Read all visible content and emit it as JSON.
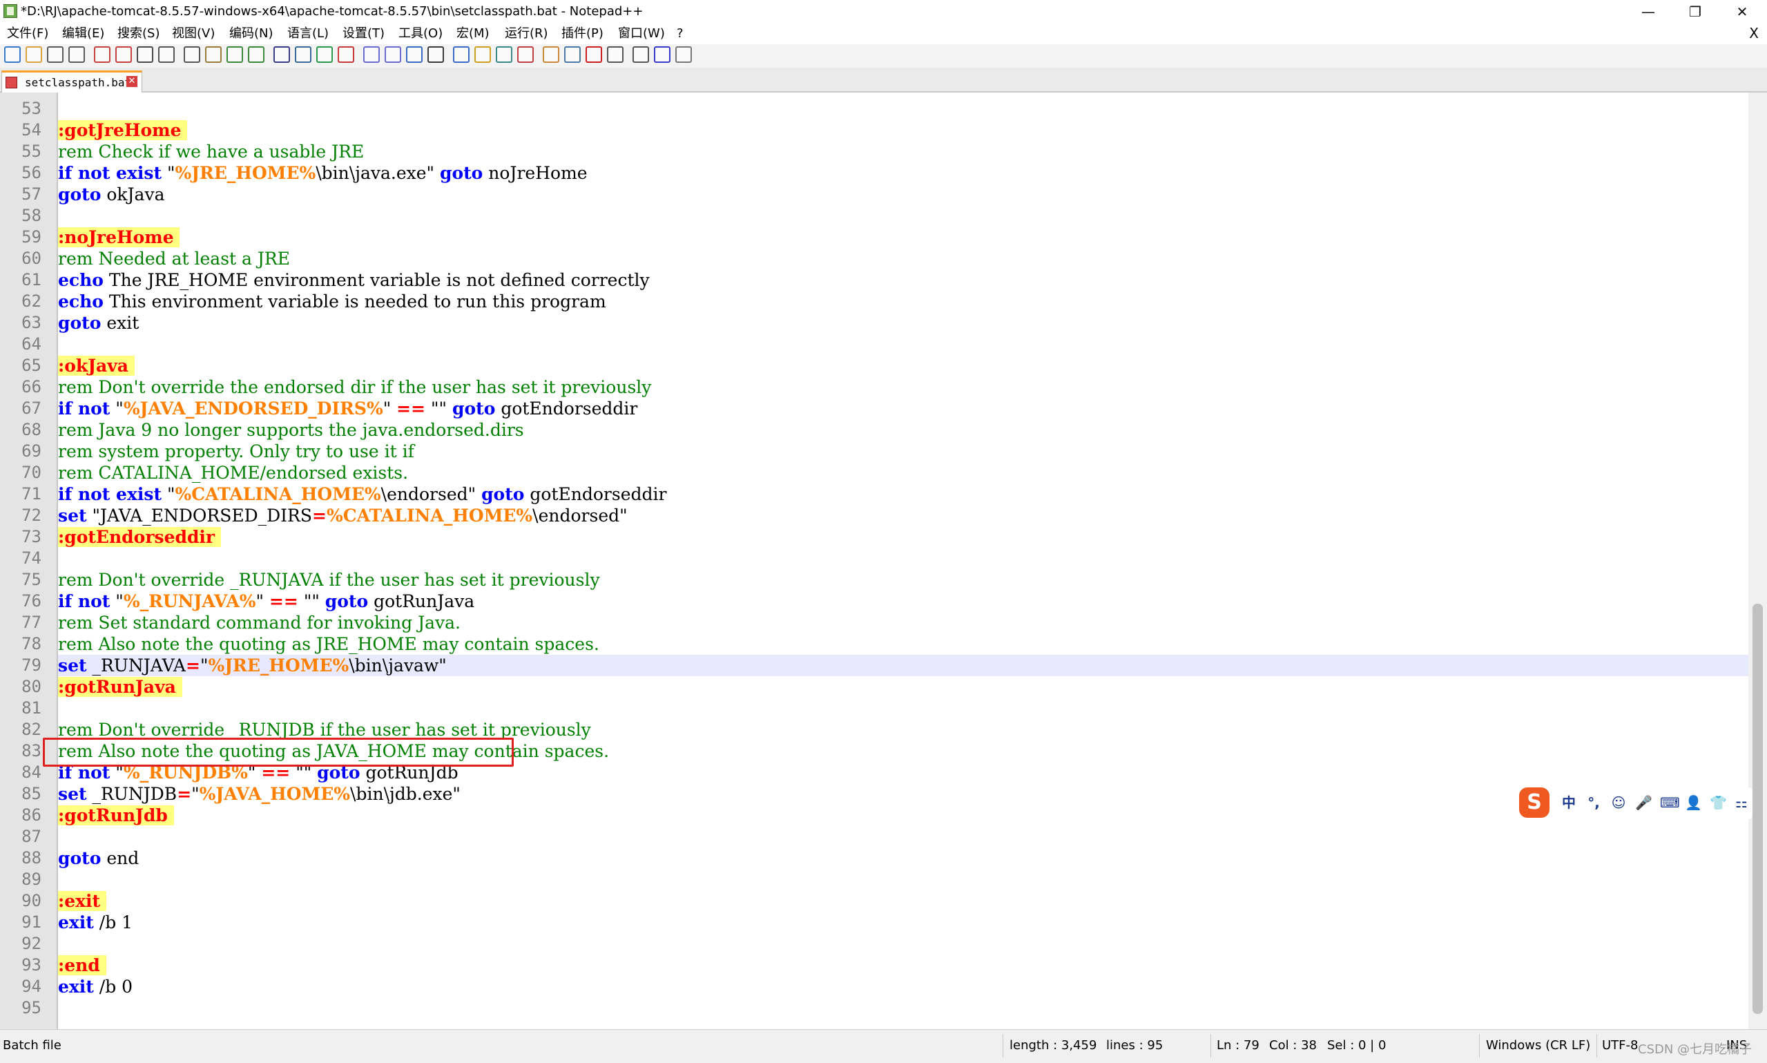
{
  "window": {
    "title": "*D:\\RJ\\apache-tomcat-8.5.57-windows-x64\\apache-tomcat-8.5.57\\bin\\setclasspath.bat - Notepad++",
    "minimize": "—",
    "maximize": "❐",
    "close": "✕"
  },
  "menu": {
    "items": [
      "文件(F)",
      "编辑(E)",
      "搜索(S)",
      "视图(V)",
      "编码(N)",
      "语言(L)",
      "设置(T)",
      "工具(O)",
      "宏(M)",
      "运行(R)",
      "插件(P)",
      "窗口(W)",
      "?"
    ],
    "close": "X"
  },
  "toolbar": {
    "buttons": [
      "new-file",
      "open-file",
      "save",
      "save-all",
      "close",
      "close-all",
      "print",
      "cut",
      "copy",
      "paste",
      "undo",
      "redo",
      "find",
      "replace",
      "zoom-in",
      "zoom-out",
      "sync-vertical",
      "sync-horizontal",
      "word-wrap",
      "show-all-chars",
      "indent-guide",
      "language-udf",
      "doc-map",
      "function-list",
      "folder-as-workspace",
      "monitoring",
      "record-macro",
      "stop-recording",
      "playback-macro",
      "run-macro-multiple",
      "save-macro"
    ]
  },
  "tab": {
    "label": "setclasspath.bat",
    "close": "✕"
  },
  "editor": {
    "lines": [
      {
        "n": "53",
        "parts": []
      },
      {
        "n": "54",
        "parts": [
          {
            "t": ":gotJreHome ",
            "c": "lbl"
          }
        ]
      },
      {
        "n": "55",
        "parts": [
          {
            "t": "rem Check if we have a usable JRE",
            "c": "cm"
          }
        ]
      },
      {
        "n": "56",
        "parts": [
          {
            "t": "if not exist",
            "c": "kw"
          },
          {
            "t": " \"",
            "c": ""
          },
          {
            "t": "%JRE_HOME%",
            "c": "var"
          },
          {
            "t": "\\bin\\java.exe\" ",
            "c": ""
          },
          {
            "t": "goto",
            "c": "kw"
          },
          {
            "t": " noJreHome",
            "c": ""
          }
        ]
      },
      {
        "n": "57",
        "parts": [
          {
            "t": "goto",
            "c": "kw"
          },
          {
            "t": " okJava",
            "c": ""
          }
        ]
      },
      {
        "n": "58",
        "parts": []
      },
      {
        "n": "59",
        "parts": [
          {
            "t": ":noJreHome ",
            "c": "lbl"
          }
        ]
      },
      {
        "n": "60",
        "parts": [
          {
            "t": "rem Needed at least a JRE",
            "c": "cm"
          }
        ]
      },
      {
        "n": "61",
        "parts": [
          {
            "t": "echo",
            "c": "kw"
          },
          {
            "t": " The JRE_HOME environment variable is not defined correctly",
            "c": ""
          }
        ]
      },
      {
        "n": "62",
        "parts": [
          {
            "t": "echo",
            "c": "kw"
          },
          {
            "t": " This environment variable is needed to run this program",
            "c": ""
          }
        ]
      },
      {
        "n": "63",
        "parts": [
          {
            "t": "goto",
            "c": "kw"
          },
          {
            "t": " exit",
            "c": ""
          }
        ]
      },
      {
        "n": "64",
        "parts": []
      },
      {
        "n": "65",
        "parts": [
          {
            "t": ":okJava ",
            "c": "lbl"
          }
        ]
      },
      {
        "n": "66",
        "parts": [
          {
            "t": "rem Don't override the endorsed dir if the user has set it previously",
            "c": "cm"
          }
        ]
      },
      {
        "n": "67",
        "parts": [
          {
            "t": "if not",
            "c": "kw"
          },
          {
            "t": " \"",
            "c": ""
          },
          {
            "t": "%JAVA_ENDORSED_DIRS%",
            "c": "var"
          },
          {
            "t": "\" ",
            "c": ""
          },
          {
            "t": "==",
            "c": "op"
          },
          {
            "t": " \"\" ",
            "c": ""
          },
          {
            "t": "goto",
            "c": "kw"
          },
          {
            "t": " gotEndorseddir",
            "c": ""
          }
        ]
      },
      {
        "n": "68",
        "parts": [
          {
            "t": "rem Java 9 no longer supports the java.endorsed.dirs",
            "c": "cm"
          }
        ]
      },
      {
        "n": "69",
        "parts": [
          {
            "t": "rem system property. Only try to use it if",
            "c": "cm"
          }
        ]
      },
      {
        "n": "70",
        "parts": [
          {
            "t": "rem CATALINA_HOME/endorsed exists.",
            "c": "cm"
          }
        ]
      },
      {
        "n": "71",
        "parts": [
          {
            "t": "if not exist",
            "c": "kw"
          },
          {
            "t": " \"",
            "c": ""
          },
          {
            "t": "%CATALINA_HOME%",
            "c": "var"
          },
          {
            "t": "\\endorsed\" ",
            "c": ""
          },
          {
            "t": "goto",
            "c": "kw"
          },
          {
            "t": " gotEndorseddir",
            "c": ""
          }
        ]
      },
      {
        "n": "72",
        "parts": [
          {
            "t": "set",
            "c": "kw"
          },
          {
            "t": " \"JAVA_ENDORSED_DIRS",
            "c": ""
          },
          {
            "t": "=",
            "c": "op"
          },
          {
            "t": "%CATALINA_HOME%",
            "c": "var"
          },
          {
            "t": "\\endorsed\"",
            "c": ""
          }
        ]
      },
      {
        "n": "73",
        "parts": [
          {
            "t": ":gotEndorseddir ",
            "c": "lbl"
          }
        ]
      },
      {
        "n": "74",
        "parts": []
      },
      {
        "n": "75",
        "parts": [
          {
            "t": "rem Don't override _RUNJAVA if the user has set it previously",
            "c": "cm"
          }
        ]
      },
      {
        "n": "76",
        "parts": [
          {
            "t": "if not",
            "c": "kw"
          },
          {
            "t": " \"",
            "c": ""
          },
          {
            "t": "%_RUNJAVA%",
            "c": "var"
          },
          {
            "t": "\" ",
            "c": ""
          },
          {
            "t": "==",
            "c": "op"
          },
          {
            "t": " \"\" ",
            "c": ""
          },
          {
            "t": "goto",
            "c": "kw"
          },
          {
            "t": " gotRunJava",
            "c": ""
          }
        ]
      },
      {
        "n": "77",
        "parts": [
          {
            "t": "rem Set standard command for invoking Java.",
            "c": "cm"
          }
        ]
      },
      {
        "n": "78",
        "parts": [
          {
            "t": "rem Also note the quoting as JRE_HOME may contain spaces.",
            "c": "cm"
          }
        ]
      },
      {
        "n": "79",
        "parts": [
          {
            "t": "set",
            "c": "kw"
          },
          {
            "t": " _RUNJAVA",
            "c": ""
          },
          {
            "t": "=",
            "c": "op"
          },
          {
            "t": "\"",
            "c": ""
          },
          {
            "t": "%JRE_HOME%",
            "c": "var"
          },
          {
            "t": "\\bin\\javaw\"",
            "c": ""
          }
        ],
        "current": true
      },
      {
        "n": "80",
        "parts": [
          {
            "t": ":gotRunJava ",
            "c": "lbl"
          }
        ]
      },
      {
        "n": "81",
        "parts": []
      },
      {
        "n": "82",
        "parts": [
          {
            "t": "rem Don't override _RUNJDB if the user has set it previously",
            "c": "cm"
          }
        ]
      },
      {
        "n": "83",
        "parts": [
          {
            "t": "rem Also note the quoting as JAVA_HOME may contain spaces.",
            "c": "cm"
          }
        ]
      },
      {
        "n": "84",
        "parts": [
          {
            "t": "if not",
            "c": "kw"
          },
          {
            "t": " \"",
            "c": ""
          },
          {
            "t": "%_RUNJDB%",
            "c": "var"
          },
          {
            "t": "\" ",
            "c": ""
          },
          {
            "t": "==",
            "c": "op"
          },
          {
            "t": " \"\" ",
            "c": ""
          },
          {
            "t": "goto",
            "c": "kw"
          },
          {
            "t": " gotRunJdb",
            "c": ""
          }
        ]
      },
      {
        "n": "85",
        "parts": [
          {
            "t": "set",
            "c": "kw"
          },
          {
            "t": " _RUNJDB",
            "c": ""
          },
          {
            "t": "=",
            "c": "op"
          },
          {
            "t": "\"",
            "c": ""
          },
          {
            "t": "%JAVA_HOME%",
            "c": "var"
          },
          {
            "t": "\\bin\\jdb.exe\"",
            "c": ""
          }
        ]
      },
      {
        "n": "86",
        "parts": [
          {
            "t": ":gotRunJdb ",
            "c": "lbl"
          }
        ]
      },
      {
        "n": "87",
        "parts": []
      },
      {
        "n": "88",
        "parts": [
          {
            "t": "goto",
            "c": "kw"
          },
          {
            "t": " end",
            "c": ""
          }
        ]
      },
      {
        "n": "89",
        "parts": []
      },
      {
        "n": "90",
        "parts": [
          {
            "t": ":exit ",
            "c": "lbl"
          }
        ]
      },
      {
        "n": "91",
        "parts": [
          {
            "t": "exit",
            "c": "kw"
          },
          {
            "t": " /b 1",
            "c": ""
          }
        ]
      },
      {
        "n": "92",
        "parts": []
      },
      {
        "n": "93",
        "parts": [
          {
            "t": ":end ",
            "c": "lbl"
          }
        ]
      },
      {
        "n": "94",
        "parts": [
          {
            "t": "exit",
            "c": "kw"
          },
          {
            "t": " /b 0",
            "c": ""
          }
        ]
      },
      {
        "n": "95",
        "parts": []
      }
    ]
  },
  "ime": {
    "logo": "S",
    "items": [
      "中",
      "°,",
      "☺",
      "🎤",
      "⌨",
      "👤",
      "👕",
      "⚏"
    ]
  },
  "status": {
    "file_type": "Batch file",
    "length": "length : 3,459",
    "lines": "lines : 95",
    "ln": "Ln : 79",
    "col": "Col : 38",
    "sel": "Sel : 0 | 0",
    "eol": "Windows (CR LF)",
    "encoding": "UTF-8",
    "mode": "INS",
    "watermark": "CSDN @七月吃橘子"
  },
  "colors": {
    "keyword": "#0000ff",
    "comment": "#008000",
    "label_fg": "#ff0000",
    "label_bg": "#ffff80",
    "variable": "#ff8000",
    "highlight_box": "#e0201f"
  }
}
